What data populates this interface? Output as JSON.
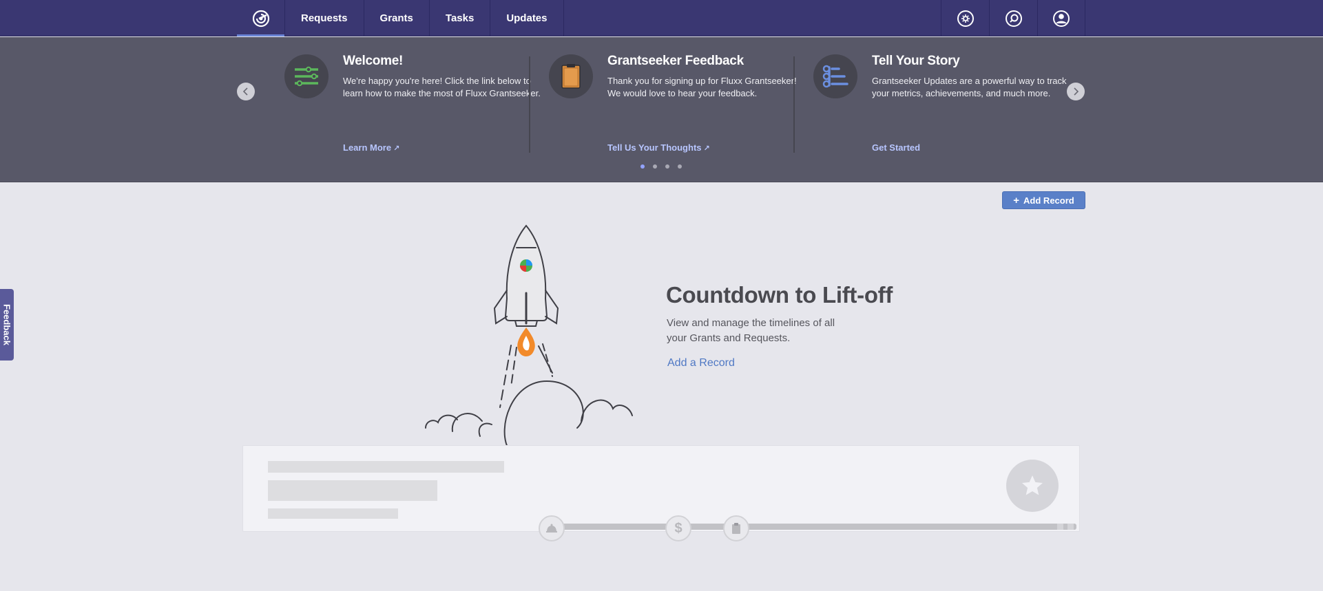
{
  "nav": {
    "tabs": [
      {
        "label": "Requests"
      },
      {
        "label": "Grants"
      },
      {
        "label": "Tasks"
      },
      {
        "label": "Updates"
      }
    ],
    "icons": [
      "settings-icon",
      "search-icon",
      "user-icon"
    ]
  },
  "carousel": {
    "cards": [
      {
        "title": "Welcome!",
        "body": "We're happy you're here! Click the link below to learn how to make the most of Fluxx Grantseeker.",
        "link": "Learn More",
        "icon": "sliders-icon"
      },
      {
        "title": "Grantseeker Feedback",
        "body": "Thank you for signing up for Fluxx Grantseeker! We would love to hear your feedback.",
        "link": "Tell Us Your Thoughts",
        "icon": "clipboard-icon"
      },
      {
        "title": "Tell Your Story",
        "body": "Grantseeker Updates are a powerful way to track your metrics, achievements, and much more.",
        "link": "Get Started",
        "icon": "list-icon"
      }
    ],
    "page_count": 4,
    "active_page": 1
  },
  "main": {
    "add_record_label": "Add Record",
    "hero_title": "Countdown to Lift-off",
    "hero_desc": "View and manage the timelines of all your Grants and Requests.",
    "hero_link": "Add a Record"
  },
  "feedback_label": "Feedback",
  "colors": {
    "nav_bg": "#3a3772",
    "carousel_bg": "#585868",
    "accent": "#5a80c8",
    "link": "#b8c6ff"
  }
}
